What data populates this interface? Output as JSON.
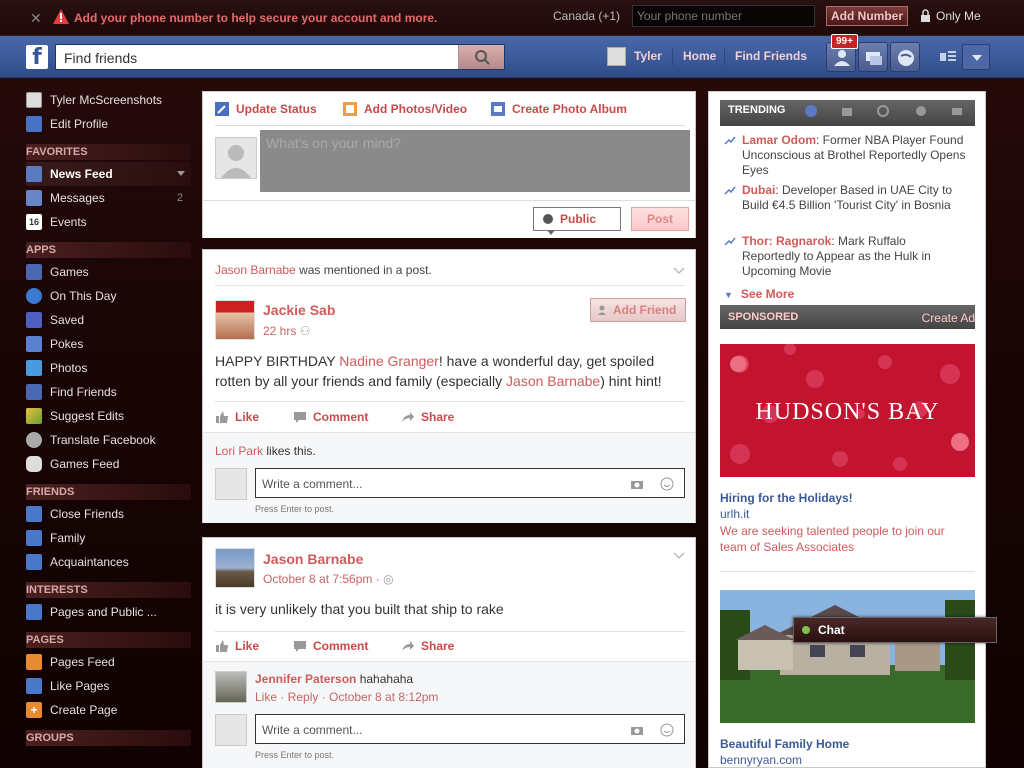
{
  "phone_bar": {
    "message": "Add your phone number to help secure your account and more.",
    "country": "Canada (+1)",
    "phone_placeholder": "Your phone number",
    "add_button": "Add Number",
    "privacy": "Only Me"
  },
  "header": {
    "logo": "f",
    "search_placeholder": "Find friends",
    "user_name": "Tyler",
    "home": "Home",
    "find_friends": "Find Friends",
    "friend_requests_badge": "99+"
  },
  "sidebar": {
    "profile_name": "Tyler McScreenshots",
    "edit_profile": "Edit Profile",
    "sections": [
      {
        "heading": "FAVORITES",
        "items": [
          {
            "label": "News Feed",
            "icon": "news-feed-icon",
            "count": ""
          },
          {
            "label": "Messages",
            "icon": "messages-icon",
            "count": "2"
          },
          {
            "label": "Events",
            "icon": "events-icon",
            "count": ""
          }
        ]
      },
      {
        "heading": "APPS",
        "items": [
          {
            "label": "Games",
            "icon": "games-icon"
          },
          {
            "label": "On This Day",
            "icon": "on-this-day-icon"
          },
          {
            "label": "Saved",
            "icon": "saved-icon"
          },
          {
            "label": "Pokes",
            "icon": "pokes-icon"
          },
          {
            "label": "Photos",
            "icon": "photos-icon"
          },
          {
            "label": "Find Friends",
            "icon": "find-friends-icon"
          },
          {
            "label": "Suggest Edits",
            "icon": "suggest-edits-icon"
          },
          {
            "label": "Translate Facebook",
            "icon": "translate-icon"
          },
          {
            "label": "Games Feed",
            "icon": "games-feed-icon"
          }
        ]
      },
      {
        "heading": "FRIENDS",
        "items": [
          {
            "label": "Close Friends",
            "icon": "close-friends-icon"
          },
          {
            "label": "Family",
            "icon": "family-icon"
          },
          {
            "label": "Acquaintances",
            "icon": "acquaintances-icon"
          }
        ]
      },
      {
        "heading": "INTERESTS",
        "items": [
          {
            "label": "Pages and Public ...",
            "icon": "pages-public-icon"
          }
        ]
      },
      {
        "heading": "PAGES",
        "items": [
          {
            "label": "Pages Feed",
            "icon": "pages-feed-icon"
          },
          {
            "label": "Like Pages",
            "icon": "like-pages-icon"
          },
          {
            "label": "Create Page",
            "icon": "create-page-icon"
          }
        ]
      },
      {
        "heading": "GROUPS",
        "items": []
      }
    ]
  },
  "composer": {
    "update_status": "Update Status",
    "add_photos": "Add Photos/Video",
    "create_album": "Create Photo Album",
    "placeholder": "What's on your mind?",
    "audience": "Public",
    "post_button": "Post"
  },
  "posts": [
    {
      "story_actor": "Jason Barnabe",
      "story_text": " was mentioned in a post.",
      "author": "Jackie Sab",
      "time": "22 hrs",
      "add_friend": "Add Friend",
      "text_before": "HAPPY BIRTHDAY ",
      "mention1": "Nadine Granger",
      "text_middle": "! have a wonderful day, get spoiled rotten by all your friends and family (especially ",
      "mention2": "Jason Barnabe",
      "text_after": ") hint hint!",
      "like": "Like",
      "comment": "Comment",
      "share": "Share",
      "liker": "Lori Park",
      "likes_suffix": " likes this.",
      "comment_placeholder": "Write a comment...",
      "press_enter": "Press Enter to post."
    },
    {
      "author": "Jason Barnabe",
      "time": "October 8 at 7:56pm",
      "text": "it is very unlikely that you built that ship to rake",
      "like": "Like",
      "comment": "Comment",
      "share": "Share",
      "commenter": "Jennifer Paterson",
      "comment_text": " hahahaha",
      "comment_meta": "Like · Reply · October 8 at 8:12pm",
      "comment_placeholder": "Write a comment...",
      "press_enter": "Press Enter to post."
    }
  ],
  "trending": {
    "heading": "TRENDING",
    "items": [
      {
        "topic": "Lamar Odom",
        "text": ": Former NBA Player Found Unconscious at Brothel Reportedly Opens Eyes"
      },
      {
        "topic": "Dubai",
        "text": ": Developer Based in UAE City to Build €4.5 Billion 'Tourist City' in Bosnia"
      },
      {
        "topic": "Thor: Ragnarok",
        "text": ": Mark Ruffalo Reportedly to Appear as the Hulk in Upcoming Movie"
      }
    ],
    "see_more": "See More"
  },
  "sponsored": {
    "heading": "SPONSORED",
    "create_ad": "Create Ad",
    "ads": [
      {
        "brand": "HUDSON'S BAY",
        "title": "Hiring for the Holidays!",
        "url": "urlh.it",
        "desc": "We are seeking talented people to join our team of Sales Associates"
      },
      {
        "title": "Beautiful Family Home",
        "url": "bennyryan.com"
      }
    ]
  },
  "chat": {
    "label": "Chat"
  },
  "colors": {
    "header_blue": "#3b5998",
    "link_red": "#d15a5a",
    "accent_red": "#c42424"
  }
}
